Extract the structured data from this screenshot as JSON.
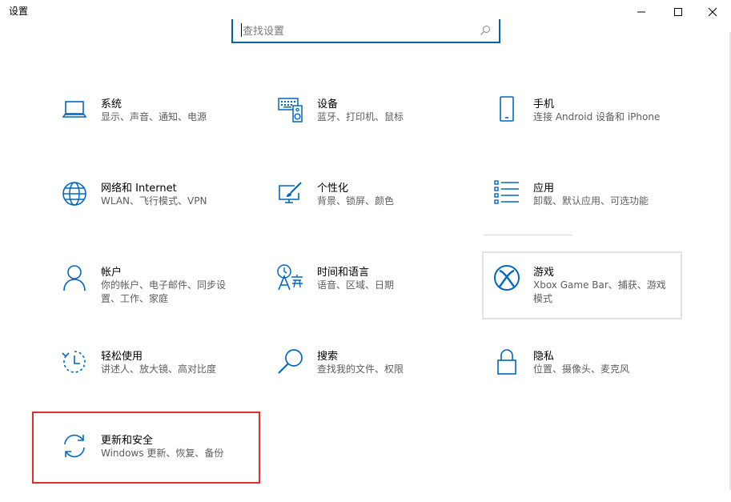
{
  "window": {
    "title": "设置",
    "accent": "#0063b1",
    "minimize_glyph": "–",
    "maximize_glyph": "□",
    "close_glyph": "✕"
  },
  "search": {
    "placeholder": "查找设置",
    "icon": "search-icon"
  },
  "tiles": [
    {
      "name": "系统",
      "desc": "显示、声音、通知、电源",
      "icon": "laptop-icon"
    },
    {
      "name": "设备",
      "desc": "蓝牙、打印机、鼠标",
      "icon": "keyboard-speaker-icon"
    },
    {
      "name": "手机",
      "desc": "连接 Android 设备和 iPhone",
      "icon": "phone-icon"
    },
    {
      "name": "网络和 Internet",
      "desc": "WLAN、飞行模式、VPN",
      "icon": "globe-icon"
    },
    {
      "name": "个性化",
      "desc": "背景、锁屏、颜色",
      "icon": "paint-monitor-icon"
    },
    {
      "name": "应用",
      "desc": "卸载、默认应用、可选功能",
      "icon": "apps-list-icon"
    },
    {
      "name": "帐户",
      "desc": "你的帐户、电子邮件、同步设置、工作、家庭",
      "icon": "person-icon"
    },
    {
      "name": "时间和语言",
      "desc": "语音、区域、日期",
      "icon": "time-language-icon"
    },
    {
      "name": "游戏",
      "desc": "Xbox Game Bar、捕获、游戏模式",
      "icon": "xbox-icon"
    },
    {
      "name": "轻松使用",
      "desc": "讲述人、放大镜、高对比度",
      "icon": "ease-of-access-icon"
    },
    {
      "name": "搜索",
      "desc": "查找我的文件、权限",
      "icon": "search-magnifier-icon"
    },
    {
      "name": "隐私",
      "desc": "位置、摄像头、麦克风",
      "icon": "lock-icon"
    },
    {
      "name": "更新和安全",
      "desc": "Windows 更新、恢复、备份",
      "icon": "sync-icon"
    }
  ]
}
